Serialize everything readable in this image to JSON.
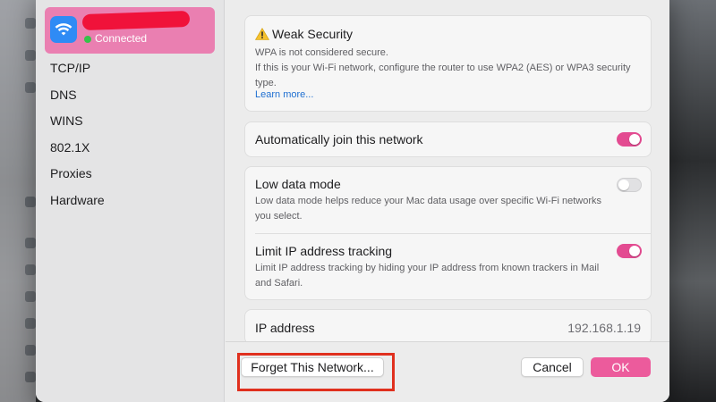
{
  "network": {
    "status": "Connected"
  },
  "sidebar": {
    "items": [
      "TCP/IP",
      "DNS",
      "WINS",
      "802.1X",
      "Proxies",
      "Hardware"
    ]
  },
  "warning": {
    "title": "Weak Security",
    "desc_line1": "WPA is not considered secure.",
    "desc_line2": "If this is your Wi-Fi network, configure the router to use WPA2 (AES) or WPA3 security type.",
    "link": "Learn more..."
  },
  "auto_join": {
    "label": "Automatically join this network",
    "enabled": true
  },
  "low_data": {
    "label": "Low data mode",
    "desc": "Low data mode helps reduce your Mac data usage over specific Wi-Fi networks you select.",
    "enabled": false
  },
  "limit_ip": {
    "label": "Limit IP address tracking",
    "desc": "Limit IP address tracking by hiding your IP address from known trackers in Mail and Safari.",
    "enabled": true
  },
  "ip": {
    "label": "IP address",
    "value": "192.168.1.19"
  },
  "footer": {
    "forget_label": "Forget This Network...",
    "cancel_label": "Cancel",
    "ok_label": "OK"
  },
  "colors": {
    "accent": "#ec5b9c",
    "toggle_on": "#e34b91",
    "highlight": "#e0301e",
    "wifi_tile": "#2f8bf5"
  },
  "icons": [
    "wifi-icon",
    "warning-icon"
  ]
}
